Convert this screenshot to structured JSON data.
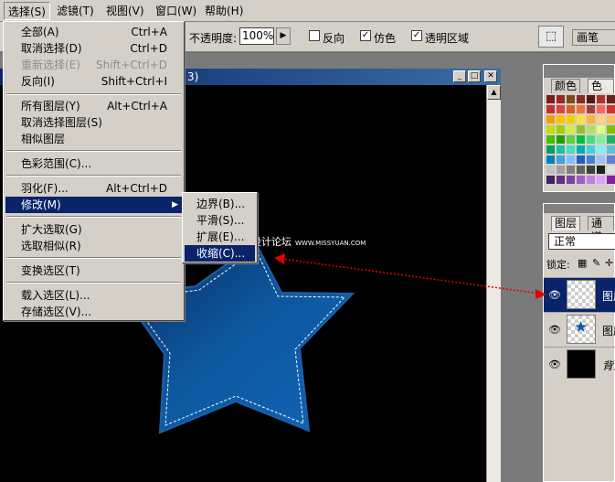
{
  "menubar": {
    "items": [
      {
        "label": "选择(S)"
      },
      {
        "label": "滤镜(T)"
      },
      {
        "label": "视图(V)"
      },
      {
        "label": "窗口(W)"
      },
      {
        "label": "帮助(H)"
      }
    ]
  },
  "options_bar": {
    "opacity_label": "不透明度:",
    "opacity_value": "100%",
    "reverse_label": "反向",
    "dither_label": "仿色",
    "transparency_label": "透明区域",
    "brushes_tab": "画笔"
  },
  "document": {
    "title_fragment": "3)"
  },
  "select_menu": {
    "items": [
      {
        "label": "全部(A)",
        "shortcut": "Ctrl+A",
        "disabled": false
      },
      {
        "label": "取消选择(D)",
        "shortcut": "Ctrl+D",
        "disabled": false
      },
      {
        "label": "重新选择(E)",
        "shortcut": "Shift+Ctrl+D",
        "disabled": true
      },
      {
        "label": "反向(I)",
        "shortcut": "Shift+Ctrl+I",
        "disabled": false
      },
      {
        "label": "所有图层(Y)",
        "shortcut": "Alt+Ctrl+A",
        "disabled": false
      },
      {
        "label": "取消选择图层(S)",
        "shortcut": "",
        "disabled": false
      },
      {
        "label": "相似图层",
        "shortcut": "",
        "disabled": false
      },
      {
        "label": "色彩范围(C)...",
        "shortcut": "",
        "disabled": false
      },
      {
        "label": "羽化(F)...",
        "shortcut": "Alt+Ctrl+D",
        "disabled": false
      },
      {
        "label": "修改(M)",
        "shortcut": "",
        "disabled": false
      },
      {
        "label": "扩大选取(G)",
        "shortcut": "",
        "disabled": false
      },
      {
        "label": "选取相似(R)",
        "shortcut": "",
        "disabled": false
      },
      {
        "label": "变换选区(T)",
        "shortcut": "",
        "disabled": false
      },
      {
        "label": "载入选区(L)...",
        "shortcut": "",
        "disabled": false
      },
      {
        "label": "存储选区(V)...",
        "shortcut": "",
        "disabled": false
      }
    ]
  },
  "modify_submenu": {
    "items": [
      {
        "label": "边界(B)..."
      },
      {
        "label": "平滑(S)..."
      },
      {
        "label": "扩展(E)..."
      },
      {
        "label": "收缩(C)..."
      }
    ]
  },
  "watermark": {
    "text": "思缘设计论坛",
    "url": "WWW.MISSYUAN.COM"
  },
  "color_panel": {
    "tab_color": "颜色",
    "tab_swatches": "色板"
  },
  "layers_panel": {
    "tab_layers": "图层",
    "tab_channels": "通道",
    "blend_mode": "正常",
    "lock_label": "锁定:",
    "layers": [
      {
        "name": "图层",
        "selected": true
      },
      {
        "name": "图层",
        "selected": false
      },
      {
        "name": "背景",
        "selected": false
      }
    ]
  },
  "colors": {
    "titlebar": "#0a246a",
    "highlight": "#0a246a",
    "star": "#0d58a0",
    "arrow": "#e00000"
  }
}
